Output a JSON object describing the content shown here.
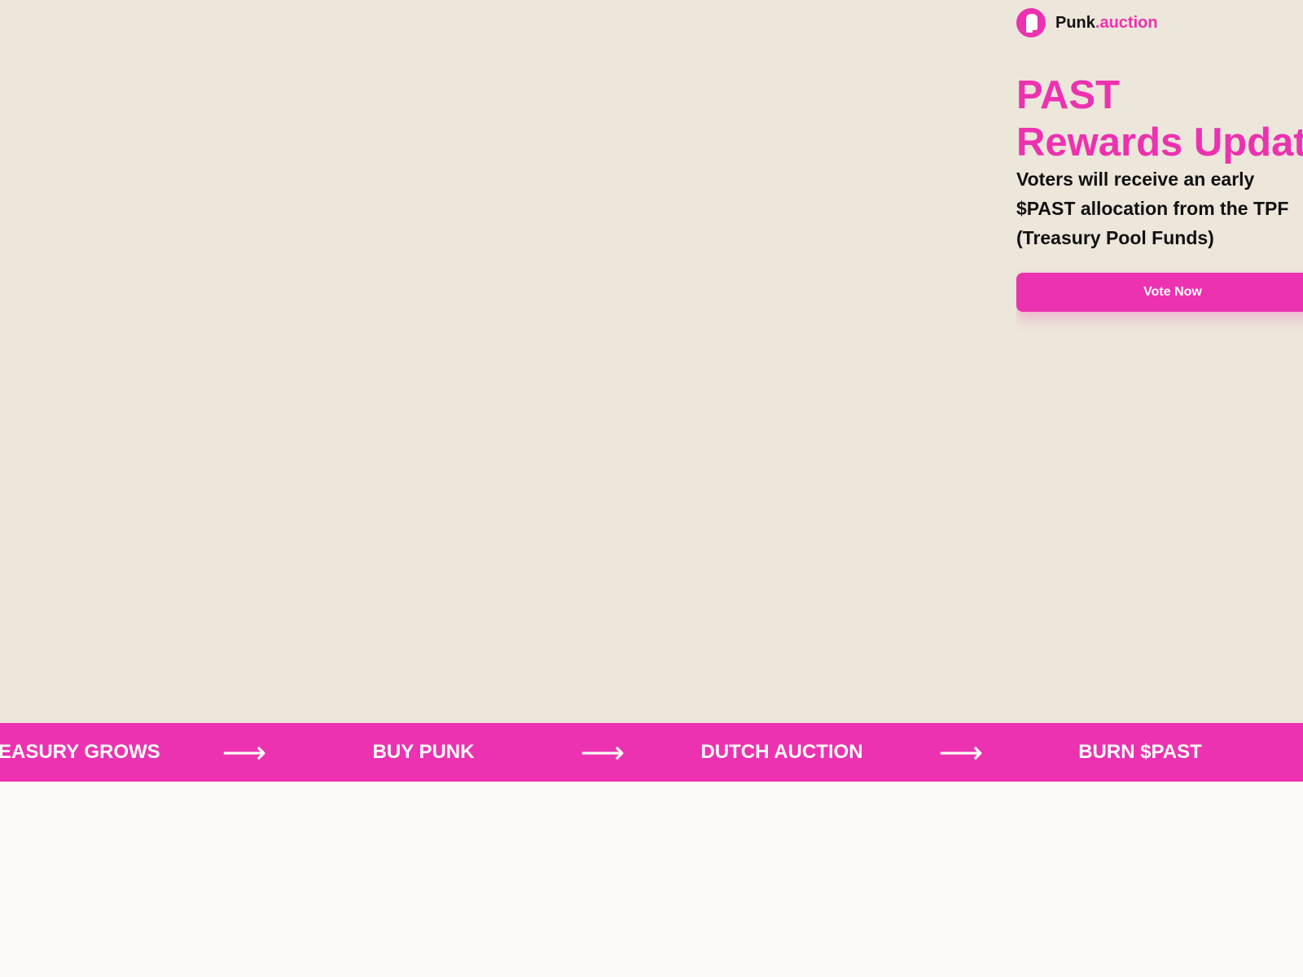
{
  "brand": {
    "name_prefix": "Punk",
    "name_suffix": ".auction",
    "logo_icon": "punk-head-icon"
  },
  "hero": {
    "headline_line1": "PAST",
    "headline_line2": "Rewards Update",
    "subtext_line1": "Voters will receive an early",
    "subtext_line2": "$PAST allocation from the TPF",
    "subtext_line3": "(Treasury Pool Funds)",
    "cta_label": "Vote Now"
  },
  "ticker": {
    "items": [
      "TREASURY GROWS",
      "BUY PUNK",
      "DUTCH AUCTION",
      "BURN $PAST"
    ],
    "separator": "⟶"
  },
  "colors": {
    "accent": "#ec32b0",
    "hero_bg": "#ede6da",
    "page_bg": "#fbfaf6",
    "text": "#111111"
  }
}
